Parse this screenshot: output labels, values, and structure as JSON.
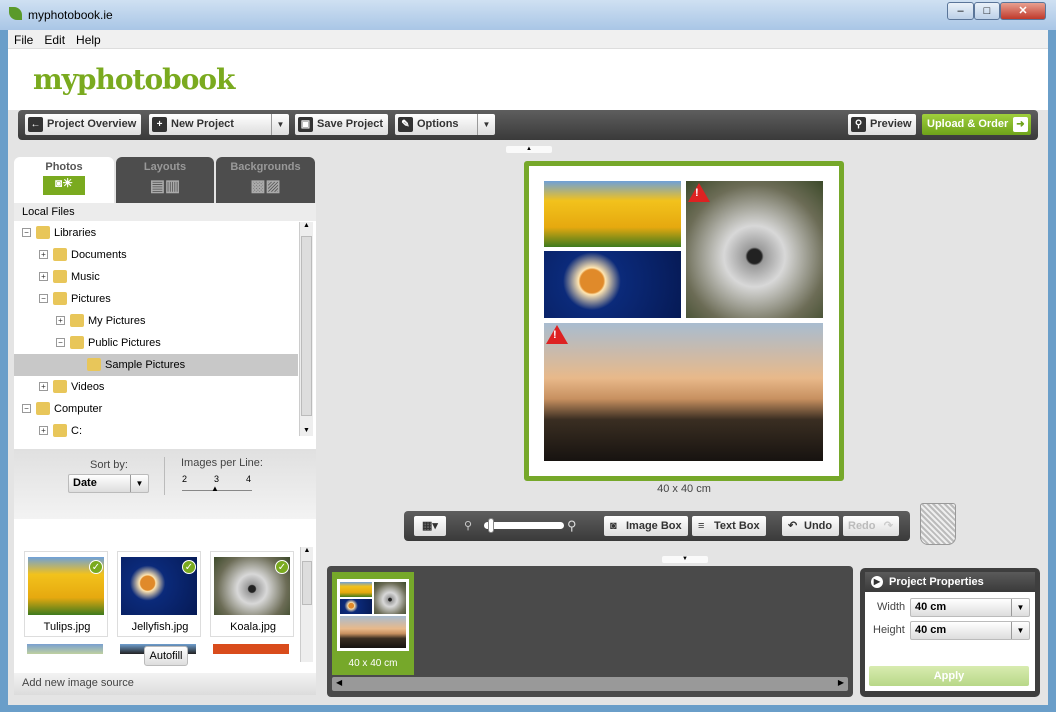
{
  "window": {
    "title": "myphotobook.ie",
    "controls": [
      "minimize",
      "maximize",
      "close"
    ]
  },
  "menu": [
    "File",
    "Edit",
    "Help"
  ],
  "logo": "myphotobook",
  "toolbar": {
    "project_overview": "Project Overview",
    "new_project": "New Project",
    "save_project": "Save Project",
    "options": "Options",
    "preview": "Preview",
    "upload_order": "Upload & Order"
  },
  "tabs": [
    {
      "label": "Photos",
      "active": true
    },
    {
      "label": "Layouts"
    },
    {
      "label": "Backgrounds"
    }
  ],
  "local_files": "Local Files",
  "tree": [
    {
      "label": "Libraries",
      "level": 0,
      "expanded": true
    },
    {
      "label": "Documents",
      "level": 1,
      "expanded": false
    },
    {
      "label": "Music",
      "level": 1,
      "expanded": false
    },
    {
      "label": "Pictures",
      "level": 1,
      "expanded": true
    },
    {
      "label": "My Pictures",
      "level": 2,
      "expanded": false
    },
    {
      "label": "Public Pictures",
      "level": 2,
      "expanded": true
    },
    {
      "label": "Sample Pictures",
      "level": 3,
      "selected": true
    },
    {
      "label": "Videos",
      "level": 1,
      "expanded": false
    },
    {
      "label": "Computer",
      "level": 0,
      "expanded": true
    },
    {
      "label": "C:",
      "level": 1,
      "expanded": false
    }
  ],
  "sort": {
    "label": "Sort by:",
    "value": "Date"
  },
  "images_per_line": {
    "label": "Images per Line:",
    "ticks": [
      "2",
      "3",
      "4"
    ],
    "value": 3
  },
  "thumbnails": [
    {
      "name": "Tulips.jpg",
      "used": true
    },
    {
      "name": "Jellyfish.jpg",
      "used": true
    },
    {
      "name": "Koala.jpg",
      "used": true
    }
  ],
  "autofill": "Autofill",
  "add_source": "Add new image source",
  "page": {
    "size": "40 x 40 cm",
    "warnings": 2
  },
  "bottom_toolbar": {
    "image_box": "Image Box",
    "text_box": "Text Box",
    "undo": "Undo",
    "redo": "Redo"
  },
  "film": [
    {
      "label": "40 x 40 cm",
      "selected": true
    }
  ],
  "properties": {
    "title": "Project Properties",
    "width_label": "Width",
    "width": "40 cm",
    "height_label": "Height",
    "height": "40 cm",
    "apply": "Apply"
  },
  "colors": {
    "accent": "#76a82a",
    "dark": "#444444"
  }
}
